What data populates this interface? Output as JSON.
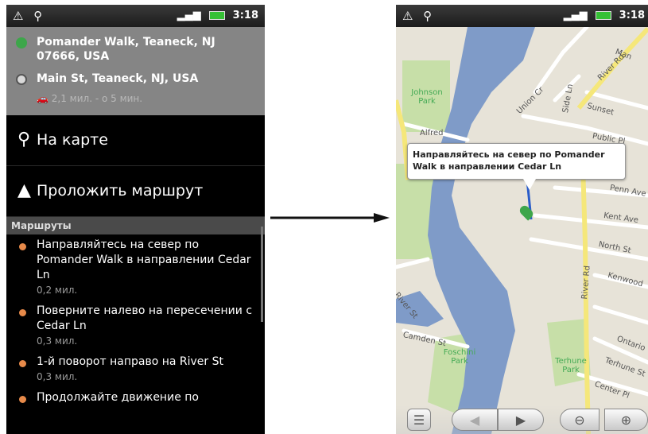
{
  "left": {
    "status": {
      "time": "3:18"
    },
    "origin": "Pomander Walk, Teaneck, NJ 07666, USA",
    "destination": "Main St, Teaneck, NJ, USA",
    "summary": "2,1 мил. - о 5 мин.",
    "menu": [
      {
        "label": "На карте",
        "icon": "map-pin-icon"
      },
      {
        "label": "Проложить маршрут",
        "icon": "navigation-arrow-icon"
      }
    ],
    "section_title": "Маршруты",
    "routes": [
      {
        "text": "Направляйтесь на север по Pomander Walk в направлении Cedar Ln",
        "dist": "0,2 мил."
      },
      {
        "text": "Поверните налево на пересечении с Cedar Ln",
        "dist": "0,3 мил."
      },
      {
        "text": "1-й поворот направо на River St",
        "dist": "0,3 мил."
      },
      {
        "text": "Продолжайте движение по",
        "dist": ""
      }
    ]
  },
  "right": {
    "status": {
      "time": "3:18"
    },
    "callout": "Направляйтесь на север по Pomander Walk в направлении Cedar Ln",
    "streets": {
      "river_rd_top": "River Rd",
      "river_rd_mid": "River Rd",
      "union_cr": "Union Cr",
      "side_ln": "Side Ln",
      "sunset": "Sunset",
      "public_pl": "Public Pl",
      "penn_ave": "Penn Ave",
      "kent_ave": "Kent Ave",
      "north_st": "North St",
      "kenwood": "Kenwood",
      "ontario": "Ontario",
      "terhune_st": "Terhune St",
      "center_pl": "Center Pl",
      "camden_st": "Camden St",
      "river_st": "River St",
      "alfred": "Alfred",
      "man": "Man"
    },
    "parks": {
      "johnson": "Johnson Park",
      "foschini": "Foschini Park",
      "terhune": "Terhune Park"
    },
    "colors": {
      "water": "#7f9bc8",
      "park": "#c7dfa8",
      "major_road": "#f5e77a",
      "land": "#e7e3d8"
    }
  }
}
